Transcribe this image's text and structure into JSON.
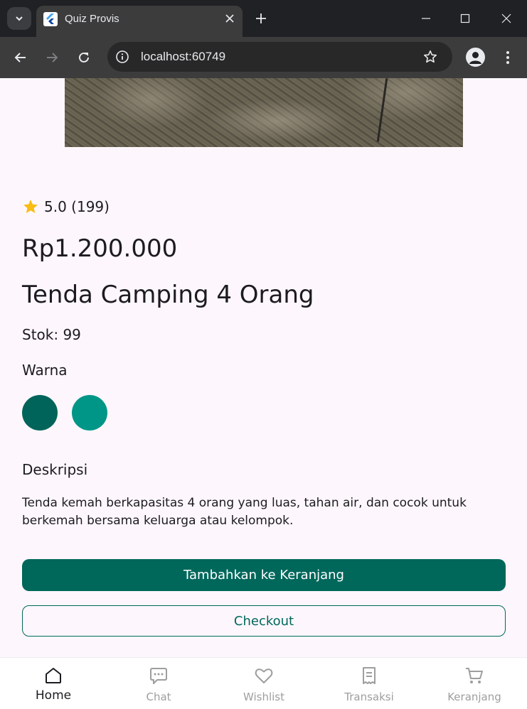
{
  "browser": {
    "tab_title": "Quiz Provis",
    "url": "localhost:60749"
  },
  "product": {
    "rating": "5.0 (199)",
    "price": "Rp1.200.000",
    "name": "Tenda Camping 4 Orang",
    "stock": "Stok: 99",
    "color_label": "Warna",
    "colors": [
      "#00645a",
      "#009687"
    ],
    "description_label": "Deskripsi",
    "description": "Tenda kemah berkapasitas 4 orang yang luas, tahan air, dan cocok untuk berkemah bersama keluarga atau kelompok.",
    "add_to_cart": "Tambahkan ke Keranjang",
    "checkout": "Checkout"
  },
  "bottom_nav": {
    "items": [
      {
        "label": "Home",
        "icon": "home-icon",
        "active": true
      },
      {
        "label": "Chat",
        "icon": "chat-icon",
        "active": false
      },
      {
        "label": "Wishlist",
        "icon": "heart-icon",
        "active": false
      },
      {
        "label": "Transaksi",
        "icon": "receipt-icon",
        "active": false
      },
      {
        "label": "Keranjang",
        "icon": "cart-icon",
        "active": false
      }
    ]
  },
  "colors": {
    "primary": "#00675b",
    "background": "#fdf7fd",
    "star": "#f9bc15"
  }
}
